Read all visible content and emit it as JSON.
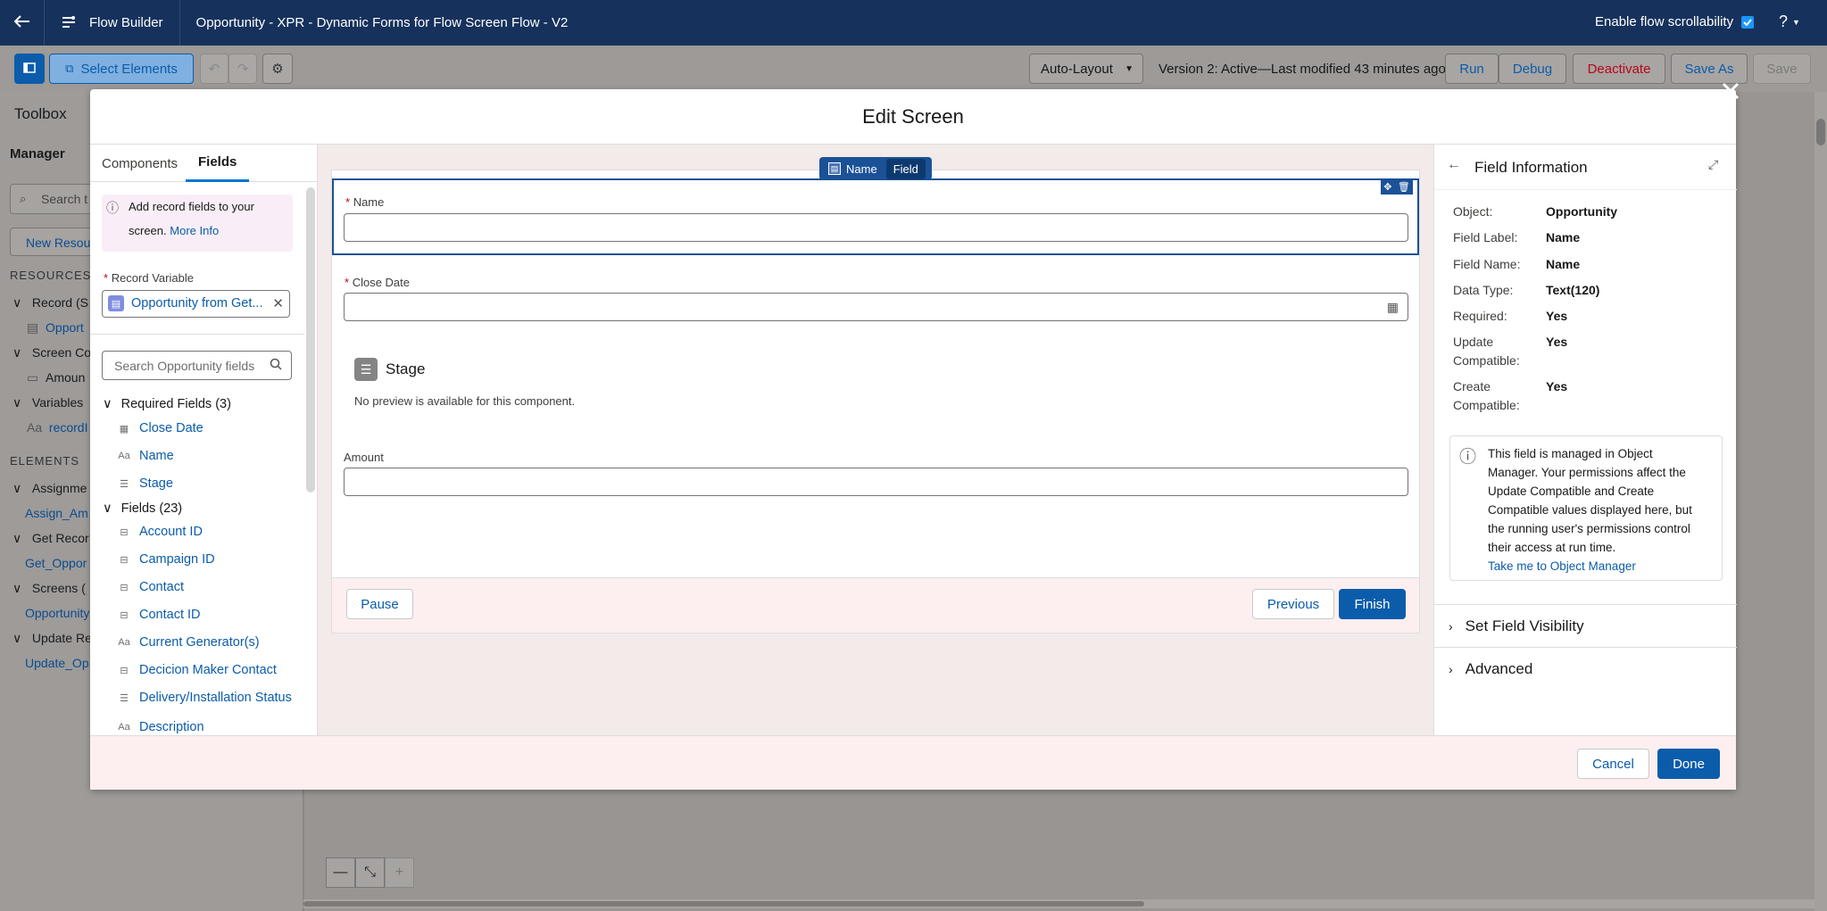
{
  "topbar": {
    "back_label": "←",
    "app_name": "Flow Builder",
    "flow_title": "Opportunity - XPR - Dynamic Forms for Flow Screen Flow - V2",
    "scroll_label": "Enable flow scrollability",
    "help_label": "?"
  },
  "toolbar": {
    "select_elements": "Select Elements",
    "layout": "Auto-Layout",
    "version_status": "Version 2: Active—Last modified 43 minutes ago",
    "run": "Run",
    "debug": "Debug",
    "deactivate": "Deactivate",
    "save_as": "Save As",
    "save": "Save"
  },
  "left_panel": {
    "toolbox": "Toolbox",
    "manager_tab": "Manager",
    "search_placeholder": "Search t",
    "new_resource": "New Resou",
    "resources_header": "RESOURCES",
    "items": [
      "Record (S",
      "Opport",
      "Screen Co",
      "Amoun",
      "Variables",
      "recordI"
    ],
    "elements_header": "ELEMENTS",
    "elements": [
      "Assignme",
      "Assign_Am",
      "Get Recor",
      "Get_Oppor",
      "Screens (",
      "Opportunity",
      "Update Re",
      "Update_Op"
    ]
  },
  "modal": {
    "title": "Edit Screen",
    "cancel": "Cancel",
    "done": "Done",
    "close_icon": "close-icon"
  },
  "palette": {
    "tab_components": "Components",
    "tab_fields": "Fields",
    "info_text_1": "Add record fields to your",
    "info_text_2": "screen.",
    "info_link": "More Info",
    "record_variable_label": "Record Variable",
    "record_variable_value": "Opportunity from Get...",
    "search_placeholder": "Search Opportunity fields",
    "required_group": "Required Fields (3)",
    "required_fields": [
      "Close Date",
      "Name",
      "Stage"
    ],
    "fields_group": "Fields (23)",
    "fields": [
      "Account ID",
      "Campaign ID",
      "Contact",
      "Contact ID",
      "Current Generator(s)",
      "Decicion Maker Contact",
      "Delivery/Installation Status",
      "Description"
    ]
  },
  "canvas": {
    "selection_badge_name": "Name",
    "selection_badge_type": "Field",
    "name_label": "Name",
    "close_date_label": "Close Date",
    "stage_title": "Stage",
    "stage_preview": "No preview is available for this component.",
    "amount_label": "Amount",
    "pause": "Pause",
    "previous": "Previous",
    "finish": "Finish"
  },
  "properties": {
    "title": "Field Information",
    "rows": [
      {
        "label": "Object:",
        "value": "Opportunity"
      },
      {
        "label": "Field Label:",
        "value": "Name"
      },
      {
        "label": "Field Name:",
        "value": "Name"
      },
      {
        "label": "Data Type:",
        "value": "Text(120)"
      },
      {
        "label": "Required:",
        "value": "Yes"
      },
      {
        "label": "Update",
        "label2": "Compatible:",
        "value": "Yes"
      },
      {
        "label": "Create",
        "label2": "Compatible:",
        "value": "Yes"
      }
    ],
    "notice_lines": [
      "This field is managed in Object",
      "Manager. Your permissions affect the",
      "Update Compatible and Create",
      "Compatible values displayed here, but",
      "the running user's permissions control",
      "their access at run time."
    ],
    "notice_link": "Take me to Object Manager",
    "section_visibility": "Set Field Visibility",
    "section_advanced": "Advanced"
  },
  "colors": {
    "brand": "#0b5cab",
    "header": "#16325c",
    "danger": "#ba0517"
  }
}
